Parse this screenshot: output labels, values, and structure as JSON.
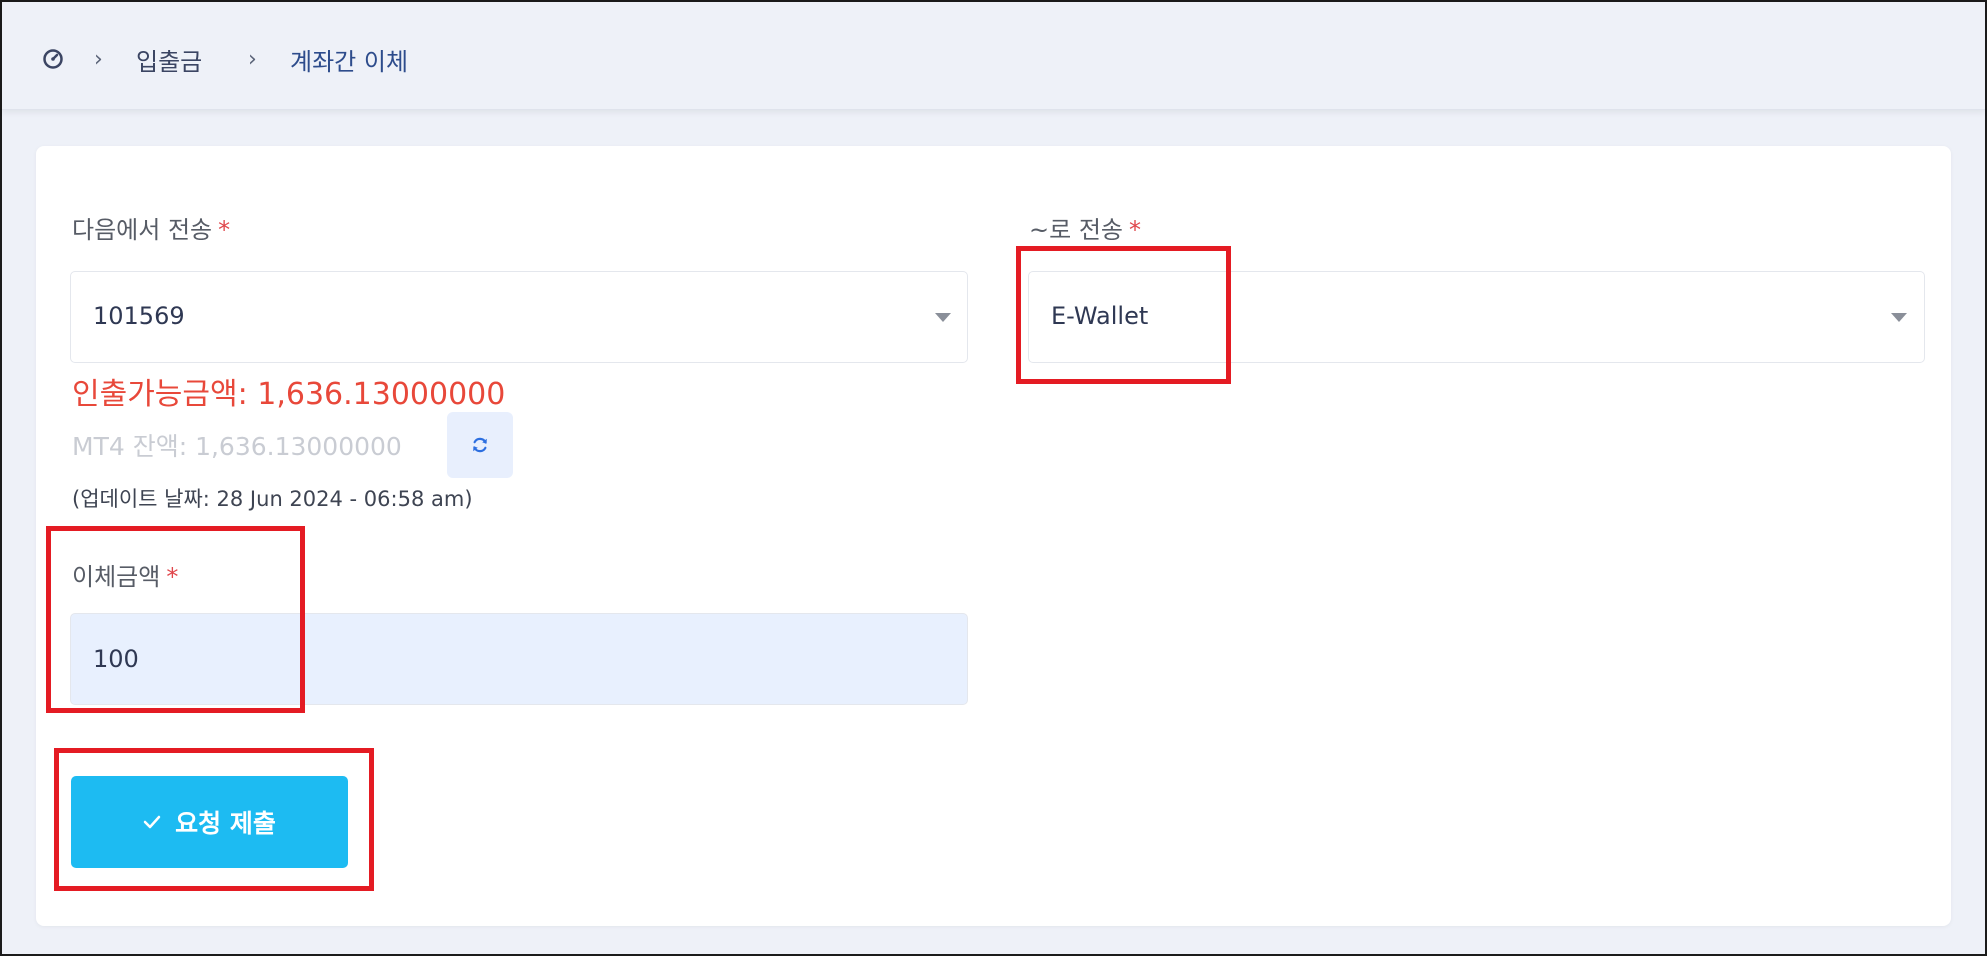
{
  "breadcrumb": {
    "home_icon": "dashboard-gauge-icon",
    "separator": "›",
    "items": [
      "입출금",
      "계좌간 이체"
    ]
  },
  "form": {
    "from": {
      "label": "다음에서 전송",
      "required_mark": "*",
      "value": "101569"
    },
    "to": {
      "label": "~로 전송",
      "required_mark": "*",
      "value": "E-Wallet"
    },
    "available": "인출가능금액: 1,636.13000000",
    "mt4_balance": "MT4 잔액: 1,636.13000000",
    "refresh_icon": "refresh-icon",
    "updated": "(업데이트 날짜: 28 Jun 2024 - 06:58 am)",
    "amount": {
      "label": "이체금액",
      "required_mark": "*",
      "value": "100"
    },
    "submit": {
      "icon": "check-icon",
      "label": "요청 제출"
    }
  },
  "colors": {
    "accent": "#1dbbf2",
    "available_text": "#e8483a",
    "highlight": "#e41b23",
    "amount_bg": "#e8f0fe"
  }
}
